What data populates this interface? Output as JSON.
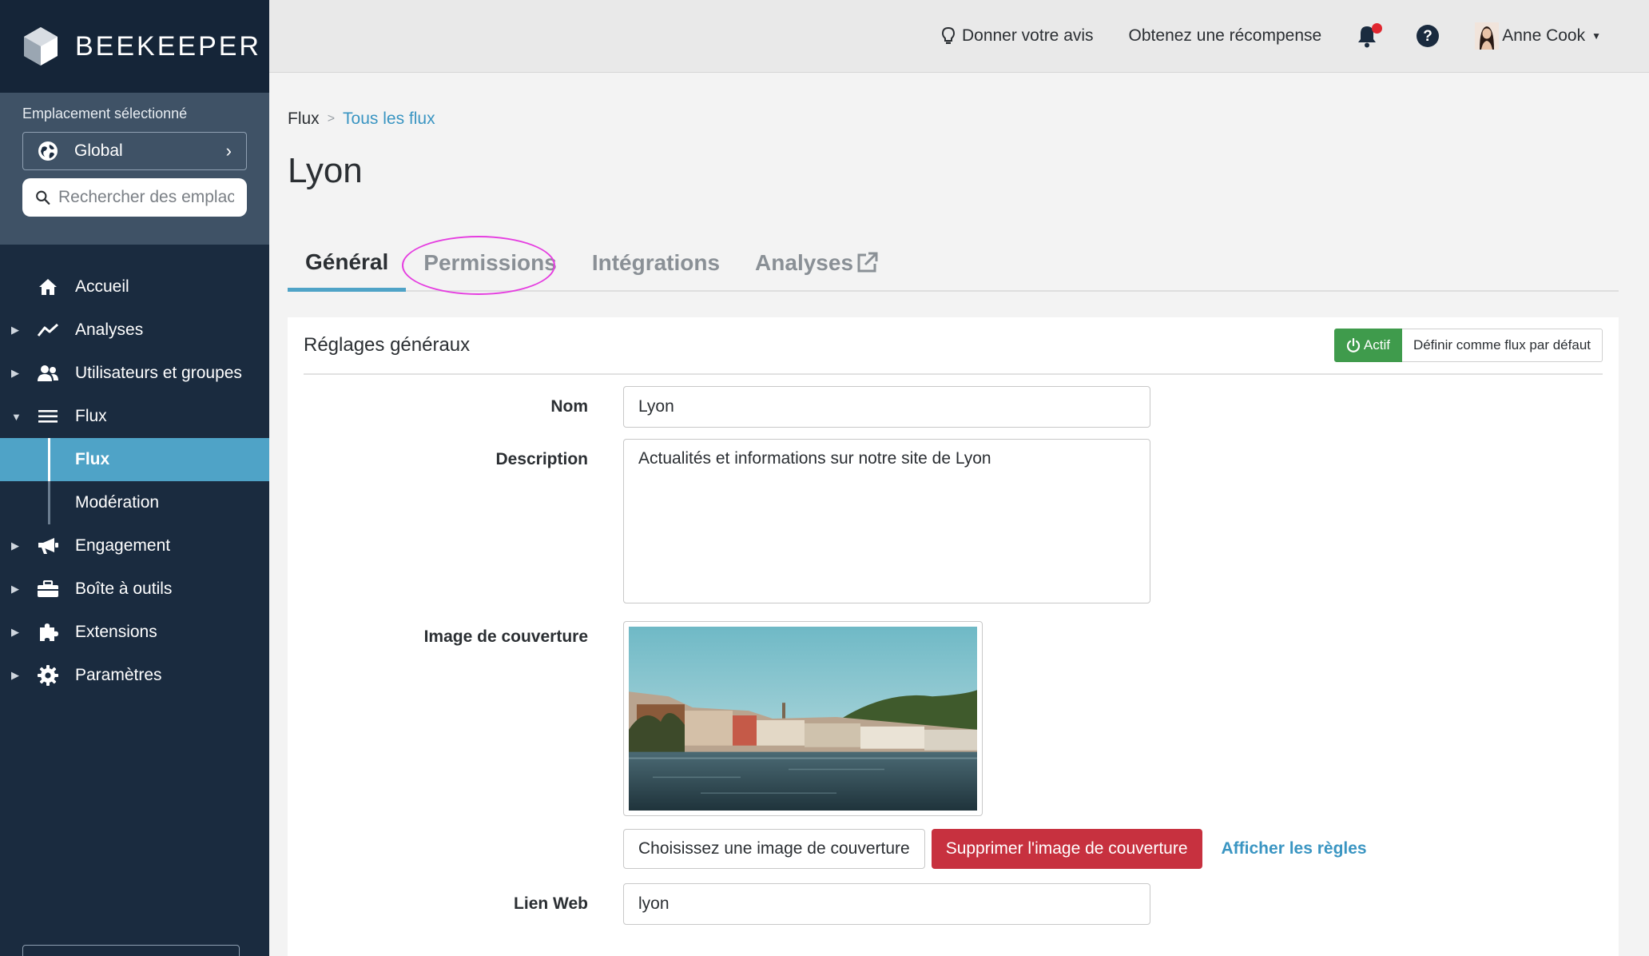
{
  "brand": {
    "name": "BEEKEEPER"
  },
  "location": {
    "label": "Emplacement sélectionné",
    "selected": "Global",
    "search_placeholder": "Rechercher des emplacements"
  },
  "nav": {
    "items": [
      {
        "label": "Accueil"
      },
      {
        "label": "Analyses"
      },
      {
        "label": "Utilisateurs et groupes"
      },
      {
        "label": "Flux"
      },
      {
        "label": "Flux"
      },
      {
        "label": "Modération"
      },
      {
        "label": "Engagement"
      },
      {
        "label": "Boîte à outils"
      },
      {
        "label": "Extensions"
      },
      {
        "label": "Paramètres"
      }
    ]
  },
  "topbar": {
    "feedback": "Donner votre avis",
    "reward": "Obtenez une récompense",
    "user": "Anne Cook"
  },
  "breadcrumb": {
    "root": "Flux",
    "sep": ">",
    "current": "Tous les flux"
  },
  "page": {
    "title": "Lyon"
  },
  "tabs": [
    {
      "label": "Général"
    },
    {
      "label": "Permissions"
    },
    {
      "label": "Intégrations"
    },
    {
      "label": "Analyses"
    }
  ],
  "card": {
    "title": "Réglages généraux",
    "active_label": "Actif",
    "default_label": "Définir comme flux par défaut"
  },
  "form": {
    "name_label": "Nom",
    "name_value": "Lyon",
    "description_label": "Description",
    "description_value": "Actualités et informations sur notre site de Lyon",
    "cover_label": "Image de couverture",
    "choose_cover": "Choisissez une image de couverture",
    "delete_cover": "Supprimer l'image de couverture",
    "show_rules": "Afficher les règles",
    "weblink_label": "Lien Web",
    "weblink_value": "lyon"
  },
  "colors": {
    "sidebar": "#1a2b3f",
    "accent": "#4fa3c7",
    "active_green": "#3f9b4c",
    "danger": "#c7313f",
    "highlight": "#e53de0"
  }
}
